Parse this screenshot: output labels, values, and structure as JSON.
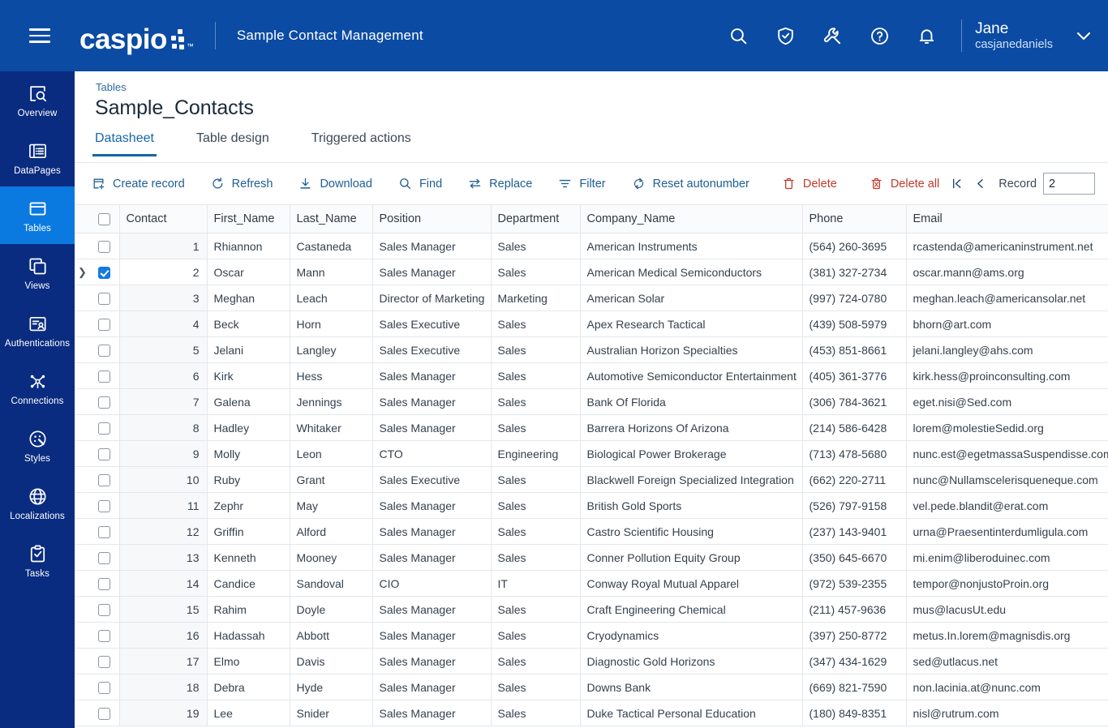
{
  "header": {
    "menu_icon": "hamburger-menu-icon",
    "logo_text": "caspio",
    "app_title": "Sample Contact Management",
    "icons": [
      "search-icon",
      "shield-check-icon",
      "wrench-icon",
      "help-circle-icon",
      "bell-icon"
    ],
    "user": {
      "name": "Jane",
      "handle": "casjanedaniels"
    },
    "brand_color": "#0b4ba3"
  },
  "sidebar": {
    "active_index": 2,
    "active_color": "#0b7ae0",
    "background_color": "#0a2c80",
    "items": [
      {
        "label": "Overview",
        "icon": "overview-search-icon"
      },
      {
        "label": "DataPages",
        "icon": "datapages-icon"
      },
      {
        "label": "Tables",
        "icon": "tables-icon"
      },
      {
        "label": "Views",
        "icon": "views-icon"
      },
      {
        "label": "Authentications",
        "icon": "authentications-icon"
      },
      {
        "label": "Connections",
        "icon": "connections-icon"
      },
      {
        "label": "Styles",
        "icon": "styles-icon"
      },
      {
        "label": "Localizations",
        "icon": "globe-icon"
      },
      {
        "label": "Tasks",
        "icon": "tasks-clipboard-icon"
      }
    ]
  },
  "page": {
    "breadcrumb": "Tables",
    "title": "Sample_Contacts",
    "tabs": [
      {
        "label": "Datasheet",
        "active": true
      },
      {
        "label": "Table design",
        "active": false
      },
      {
        "label": "Triggered actions",
        "active": false
      }
    ]
  },
  "toolbar": {
    "buttons": [
      {
        "label": "Create record",
        "icon": "create-record-icon",
        "danger": false
      },
      {
        "label": "Refresh",
        "icon": "refresh-icon",
        "danger": false
      },
      {
        "label": "Download",
        "icon": "download-icon",
        "danger": false
      },
      {
        "label": "Find",
        "icon": "find-search-icon",
        "danger": false
      },
      {
        "label": "Replace",
        "icon": "replace-swap-icon",
        "danger": false
      },
      {
        "label": "Filter",
        "icon": "filter-icon",
        "danger": false
      },
      {
        "label": "Reset autonumber",
        "icon": "reset-autonumber-icon",
        "danger": false
      },
      {
        "label": "Delete",
        "icon": "trash-icon",
        "danger": true
      },
      {
        "label": "Delete all",
        "icon": "trash-all-icon",
        "danger": true
      }
    ],
    "first_record_icon": "first-record-icon",
    "prev_record_icon": "previous-record-icon",
    "record_label": "Record",
    "record_value": "2",
    "danger_color": "#c0392b",
    "link_color": "#1d5e94"
  },
  "table": {
    "columns": [
      "Contact",
      "First_Name",
      "Last_Name",
      "Position",
      "Department",
      "Company_Name",
      "Phone",
      "Email"
    ],
    "header_checkbox_checked": false,
    "selected_row_id": 2,
    "rows": [
      {
        "id": 1,
        "first": "Rhiannon",
        "last": "Castaneda",
        "position": "Sales Manager",
        "department": "Sales",
        "company": "American Instruments",
        "phone": "(564) 260-3695",
        "email": "rcastenda@americaninstrument.net",
        "checked": false
      },
      {
        "id": 2,
        "first": "Oscar",
        "last": "Mann",
        "position": "Sales Manager",
        "department": "Sales",
        "company": "American Medical Semiconductors",
        "phone": "(381) 327-2734",
        "email": "oscar.mann@ams.org",
        "checked": true
      },
      {
        "id": 3,
        "first": "Meghan",
        "last": "Leach",
        "position": "Director of Marketing",
        "department": "Marketing",
        "company": "American Solar",
        "phone": "(997) 724-0780",
        "email": "meghan.leach@americansolar.net",
        "checked": false
      },
      {
        "id": 4,
        "first": "Beck",
        "last": "Horn",
        "position": "Sales Executive",
        "department": "Sales",
        "company": "Apex Research Tactical",
        "phone": "(439) 508-5979",
        "email": "bhorn@art.com",
        "checked": false
      },
      {
        "id": 5,
        "first": "Jelani",
        "last": "Langley",
        "position": "Sales Executive",
        "department": "Sales",
        "company": "Australian Horizon Specialties",
        "phone": "(453) 851-8661",
        "email": "jelani.langley@ahs.com",
        "checked": false
      },
      {
        "id": 6,
        "first": "Kirk",
        "last": "Hess",
        "position": "Sales Manager",
        "department": "Sales",
        "company": "Automotive Semiconductor Entertainment",
        "phone": "(405) 361-3776",
        "email": "kirk.hess@proinconsulting.com",
        "checked": false
      },
      {
        "id": 7,
        "first": "Galena",
        "last": "Jennings",
        "position": "Sales Manager",
        "department": "Sales",
        "company": "Bank Of Florida",
        "phone": "(306) 784-3621",
        "email": "eget.nisi@Sed.com",
        "checked": false
      },
      {
        "id": 8,
        "first": "Hadley",
        "last": "Whitaker",
        "position": "Sales Manager",
        "department": "Sales",
        "company": "Barrera Horizons Of Arizona",
        "phone": "(214) 586-6428",
        "email": "lorem@molestieSedid.org",
        "checked": false
      },
      {
        "id": 9,
        "first": "Molly",
        "last": "Leon",
        "position": "CTO",
        "department": "Engineering",
        "company": "Biological Power Brokerage",
        "phone": "(713) 478-5680",
        "email": "nunc.est@egetmassaSuspendisse.com",
        "checked": false
      },
      {
        "id": 10,
        "first": "Ruby",
        "last": "Grant",
        "position": "Sales Executive",
        "department": "Sales",
        "company": "Blackwell Foreign Specialized Integration",
        "phone": "(662) 220-2711",
        "email": "nunc@Nullamscelerisqueneque.com",
        "checked": false
      },
      {
        "id": 11,
        "first": "Zephr",
        "last": "May",
        "position": "Sales Manager",
        "department": "Sales",
        "company": "British Gold Sports",
        "phone": "(526) 797-9158",
        "email": "vel.pede.blandit@erat.com",
        "checked": false
      },
      {
        "id": 12,
        "first": "Griffin",
        "last": "Alford",
        "position": "Sales Manager",
        "department": "Sales",
        "company": "Castro Scientific Housing",
        "phone": "(237) 143-9401",
        "email": "urna@Praesentinterdumligula.com",
        "checked": false
      },
      {
        "id": 13,
        "first": "Kenneth",
        "last": "Mooney",
        "position": "Sales Manager",
        "department": "Sales",
        "company": "Conner Pollution Equity Group",
        "phone": "(350) 645-6670",
        "email": "mi.enim@liberoduinec.com",
        "checked": false
      },
      {
        "id": 14,
        "first": "Candice",
        "last": "Sandoval",
        "position": "CIO",
        "department": "IT",
        "company": "Conway Royal Mutual Apparel",
        "phone": "(972) 539-2355",
        "email": "tempor@nonjustoProin.org",
        "checked": false
      },
      {
        "id": 15,
        "first": "Rahim",
        "last": "Doyle",
        "position": "Sales Manager",
        "department": "Sales",
        "company": "Craft Engineering Chemical",
        "phone": "(211) 457-9636",
        "email": "mus@lacusUt.edu",
        "checked": false
      },
      {
        "id": 16,
        "first": "Hadassah",
        "last": "Abbott",
        "position": "Sales Manager",
        "department": "Sales",
        "company": "Cryodynamics",
        "phone": "(397) 250-8772",
        "email": "metus.In.lorem@magnisdis.org",
        "checked": false
      },
      {
        "id": 17,
        "first": "Elmo",
        "last": "Davis",
        "position": "Sales Manager",
        "department": "Sales",
        "company": "Diagnostic Gold Horizons",
        "phone": "(347) 434-1629",
        "email": "sed@utlacus.net",
        "checked": false
      },
      {
        "id": 18,
        "first": "Debra",
        "last": "Hyde",
        "position": "Sales Manager",
        "department": "Sales",
        "company": "Downs Bank",
        "phone": "(669) 821-7590",
        "email": "non.lacinia.at@nunc.com",
        "checked": false
      },
      {
        "id": 19,
        "first": "Lee",
        "last": "Snider",
        "position": "Sales Manager",
        "department": "Sales",
        "company": "Duke Tactical Personal Education",
        "phone": "(180) 849-8351",
        "email": "nisl@rutrum.com",
        "checked": false
      }
    ]
  }
}
